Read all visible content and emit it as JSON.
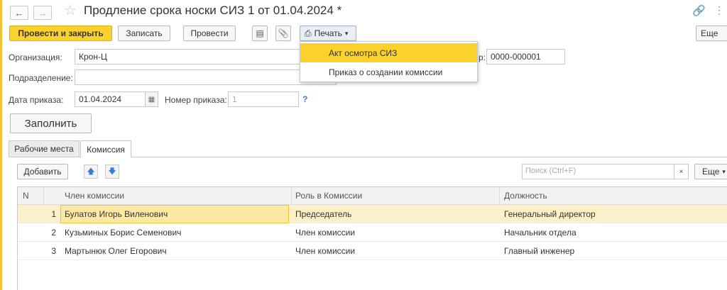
{
  "window": {
    "title": "Продление срока носки СИЗ 1 от 01.04.2024 *"
  },
  "toolbar": {
    "post_close_label": "Провести и закрыть",
    "save_label": "Записать",
    "post_label": "Провести",
    "print_label": "Печать",
    "more_label": "Еще"
  },
  "print_menu": {
    "items": [
      {
        "label": "Акт осмотра СИЗ"
      },
      {
        "label": "Приказ о создании комиссии"
      }
    ]
  },
  "form": {
    "organization_label": "Организация:",
    "organization_value": "Крон-Ц",
    "number_label_partial": "р:",
    "number_value": "0000-000001",
    "department_label": "Подразделение:",
    "department_value": "",
    "order_date_label": "Дата приказа:",
    "order_date_value": "01.04.2024",
    "order_number_label": "Номер приказа:",
    "order_number_value": "1",
    "help_mark": "?"
  },
  "fill_button_label": "Заполнить",
  "tabs": [
    {
      "label": "Рабочие места"
    },
    {
      "label": "Комиссия"
    }
  ],
  "table_toolbar": {
    "add_label": "Добавить",
    "search_placeholder": "Поиск (Ctrl+F)",
    "clear_symbol": "×",
    "more_label": "Еще"
  },
  "table": {
    "columns": [
      "N",
      "Член комиссии",
      "Роль в Комиссии",
      "Должность"
    ],
    "rows": [
      {
        "n": "1",
        "member": "Булатов Игорь Виленович",
        "role": "Председатель",
        "position": "Генеральный директор"
      },
      {
        "n": "2",
        "member": "Кузьминых Борис Семенович",
        "role": "Член комиссии",
        "position": "Начальник отдела"
      },
      {
        "n": "3",
        "member": "Мартынюк Олег Егорович",
        "role": "Член комиссии",
        "position": "Главный инженер"
      }
    ]
  }
}
